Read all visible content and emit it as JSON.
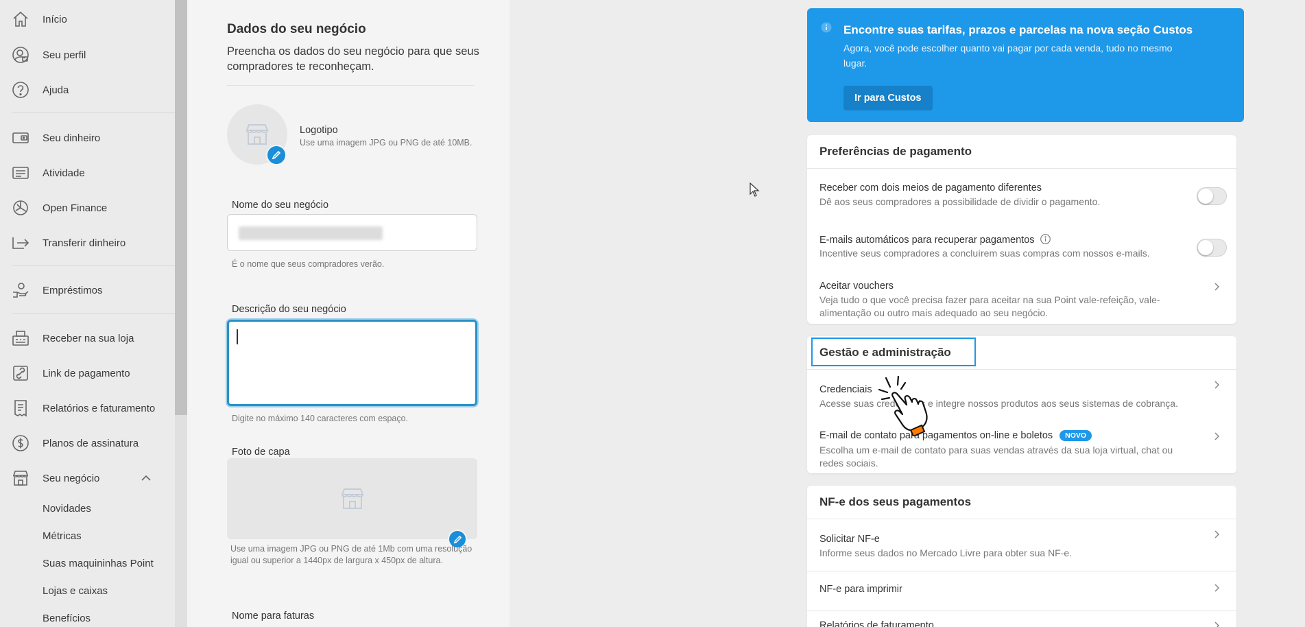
{
  "sidebar": {
    "items": [
      {
        "label": "Início",
        "icon": "home-icon"
      },
      {
        "label": "Seu perfil",
        "icon": "profile-icon"
      },
      {
        "label": "Ajuda",
        "icon": "help-icon"
      },
      {
        "label": "Seu dinheiro",
        "icon": "wallet-icon"
      },
      {
        "label": "Atividade",
        "icon": "activity-icon"
      },
      {
        "label": "Open Finance",
        "icon": "open-finance-icon"
      },
      {
        "label": "Transferir dinheiro",
        "icon": "transfer-icon"
      },
      {
        "label": "Empréstimos",
        "icon": "loan-icon"
      },
      {
        "label": "Receber na sua loja",
        "icon": "store-register-icon"
      },
      {
        "label": "Link de pagamento",
        "icon": "link-icon"
      },
      {
        "label": "Relatórios e faturamento",
        "icon": "report-icon"
      },
      {
        "label": "Planos de assinatura",
        "icon": "subscription-icon"
      },
      {
        "label": "Seu negócio",
        "icon": "business-icon",
        "expanded": true
      }
    ],
    "subitems": [
      "Novidades",
      "Métricas",
      "Suas maquininhas Point",
      "Lojas e caixas",
      "Benefícios"
    ]
  },
  "form": {
    "title": "Dados do seu negócio",
    "subtitle": "Preencha os dados do seu negócio para que seus compradores te reconheçam.",
    "logo_title": "Logotipo",
    "logo_hint": "Use uma imagem JPG ou PNG de até 10MB.",
    "name_label": "Nome do seu negócio",
    "name_hint": "É o nome que seus compradores verão.",
    "desc_label": "Descrição do seu negócio",
    "desc_hint": "Digite no máximo 140 caracteres com espaço.",
    "cover_label": "Foto de capa",
    "cover_hint": "Use uma imagem JPG ou PNG de até 1Mb com uma resolução igual ou superior a 1440px de largura x 450px de altura.",
    "invoice_label": "Nome para faturas"
  },
  "banner": {
    "title": "Encontre suas tarifas, prazos e parcelas na nova seção Custos",
    "text": "Agora, você pode escolher quanto vai pagar por cada venda, tudo no mesmo lugar.",
    "button": "Ir para Custos",
    "color": "#1e98e8"
  },
  "payment_prefs": {
    "title": "Preferências de pagamento",
    "rows": [
      {
        "title": "Receber com dois meios de pagamento diferentes",
        "desc": "Dê aos seus compradores a possibilidade de dividir o pagamento.",
        "control": "toggle",
        "on": false
      },
      {
        "title": "E-mails automáticos para recuperar pagamentos",
        "desc": "Incentive seus compradores a concluírem suas compras com nossos e-mails.",
        "control": "toggle",
        "on": false
      },
      {
        "title": "Aceitar vouchers",
        "desc": "Veja tudo o que você precisa fazer para aceitar na sua Point vale-refeição, vale-alimentação ou outro mais adequado ao seu negócio.",
        "control": "chevron"
      }
    ]
  },
  "management": {
    "title": "Gestão e administração",
    "rows": [
      {
        "title": "Credenciais",
        "desc": "Acesse suas credenciais e integre nossos produtos aos seus sistemas de cobrança."
      },
      {
        "title": "E-mail de contato para pagamentos on-line e boletos",
        "badge": "NOVO",
        "desc": "Escolha um e-mail de contato para suas vendas através da sua loja virtual, chat ou redes sociais."
      }
    ]
  },
  "nfe": {
    "title": "NF-e dos seus pagamentos",
    "rows": [
      {
        "title": "Solicitar NF-e",
        "desc": "Informe seus dados no Mercado Livre para obter sua NF-e."
      },
      {
        "title": "NF-e para imprimir"
      },
      {
        "title": "Relatórios de faturamento"
      }
    ]
  }
}
